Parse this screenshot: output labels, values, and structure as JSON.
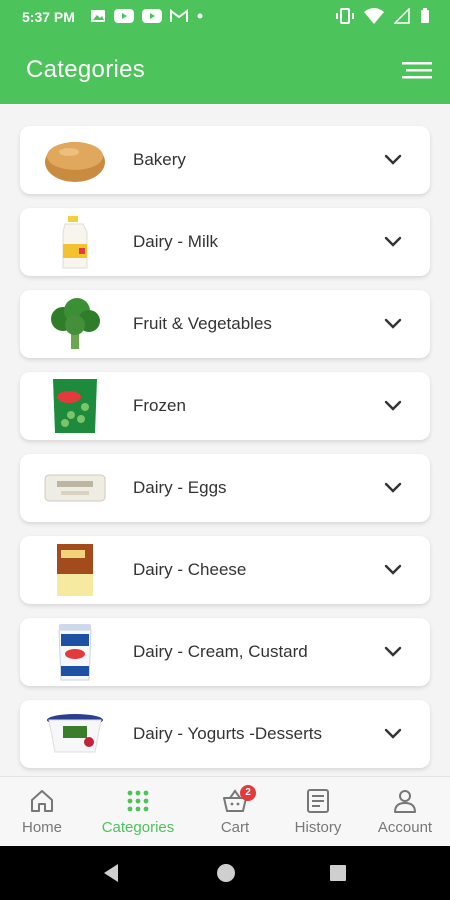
{
  "status_bar": {
    "time": "5:37 PM"
  },
  "header": {
    "title": "Categories"
  },
  "categories": [
    {
      "label": "Bakery",
      "icon": "bread-image"
    },
    {
      "label": "Dairy - Milk",
      "icon": "milk-bottle-image"
    },
    {
      "label": "Fruit & Vegetables",
      "icon": "broccoli-image"
    },
    {
      "label": "Frozen",
      "icon": "frozen-peas-bag-image"
    },
    {
      "label": "Dairy - Eggs",
      "icon": "egg-box-image"
    },
    {
      "label": "Dairy - Cheese",
      "icon": "cheese-pack-image"
    },
    {
      "label": "Dairy - Cream, Custard",
      "icon": "cream-tub-image"
    },
    {
      "label": "Dairy - Yogurts -Desserts",
      "icon": "yogurt-tub-image"
    }
  ],
  "bottom_nav": {
    "items": [
      {
        "label": "Home",
        "icon": "home-icon"
      },
      {
        "label": "Categories",
        "icon": "grid-icon",
        "active": true
      },
      {
        "label": "Cart",
        "icon": "basket-icon",
        "badge": "2"
      },
      {
        "label": "History",
        "icon": "history-icon"
      },
      {
        "label": "Account",
        "icon": "user-icon"
      }
    ]
  },
  "colors": {
    "primary": "#4cc35b",
    "badge": "#e23b3b"
  }
}
